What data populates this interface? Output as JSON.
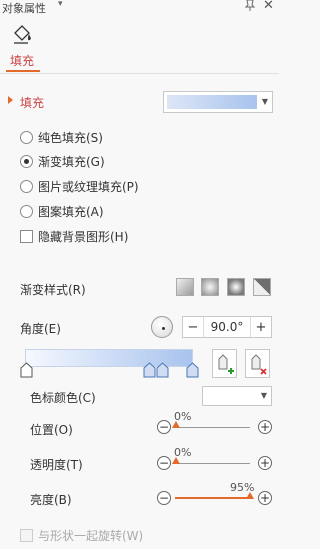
{
  "panel": {
    "title": "对象属性",
    "tab_label": "填充"
  },
  "fill": {
    "section_title": "填充",
    "options": [
      {
        "label": "纯色填充(S)",
        "selected": false
      },
      {
        "label": "渐变填充(G)",
        "selected": true
      },
      {
        "label": "图片或纹理填充(P)",
        "selected": false
      },
      {
        "label": "图案填充(A)",
        "selected": false
      }
    ],
    "hide_bg": {
      "label": "隐藏背景图形(H)",
      "checked": false
    }
  },
  "gradient": {
    "style_label": "渐变样式(R)",
    "angle_label": "角度(E)",
    "angle_value": "90.0°",
    "minus": "−",
    "plus": "+",
    "stop_color_label": "色标颜色(C)",
    "position": {
      "label": "位置(O)",
      "value": "0%",
      "level": 0
    },
    "transparency": {
      "label": "透明度(T)",
      "value": "0%",
      "level": 0
    },
    "brightness": {
      "label": "亮度(B)",
      "value": "95%",
      "level": 95
    },
    "rotate_with_shape": {
      "label": "与形状一起旋转(W)",
      "checked": false,
      "disabled": true
    }
  },
  "colors": {
    "accent": "#e46a2c",
    "tab_text": "#cc4444",
    "gradient_start": "#f5f8fe",
    "gradient_end": "#a8c3ee"
  }
}
